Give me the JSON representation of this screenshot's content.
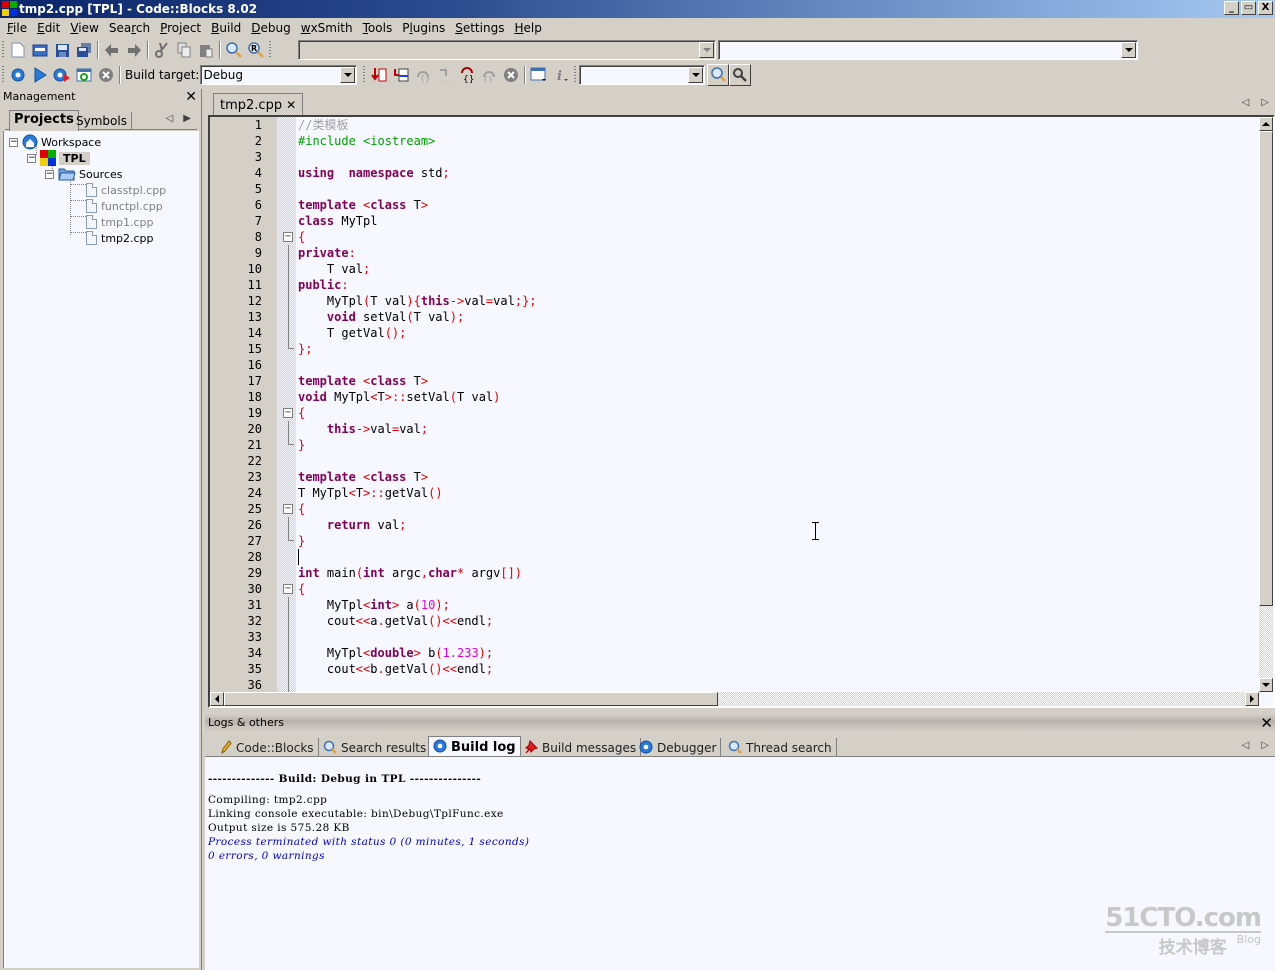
{
  "window": {
    "title": "tmp2.cpp [TPL] - Code::Blocks 8.02",
    "controls": {
      "minimize": "_",
      "restore": "▭",
      "close": "X"
    }
  },
  "menubar": [
    {
      "label": "File",
      "accel": "F"
    },
    {
      "label": "Edit",
      "accel": "E"
    },
    {
      "label": "View",
      "accel": "V"
    },
    {
      "label": "Search",
      "accel": "r"
    },
    {
      "label": "Project",
      "accel": "P"
    },
    {
      "label": "Build",
      "accel": "B"
    },
    {
      "label": "Debug",
      "accel": "D"
    },
    {
      "label": "wxSmith",
      "accel": "w"
    },
    {
      "label": "Tools",
      "accel": "T"
    },
    {
      "label": "Plugins",
      "accel": "l"
    },
    {
      "label": "Settings",
      "accel": "S"
    },
    {
      "label": "Help",
      "accel": "H"
    }
  ],
  "toolbar_main": {
    "buttons": [
      "new-file",
      "open",
      "save",
      "save-all",
      "undo",
      "redo",
      "cut",
      "copy",
      "paste",
      "find",
      "replace"
    ],
    "scope_combo": {
      "value": "",
      "disabled": true
    },
    "function_combo": {
      "value": ""
    }
  },
  "toolbar_build": {
    "buttons": [
      "build",
      "run",
      "build-and-run",
      "rebuild",
      "abort"
    ],
    "build_target_label": "Build target:",
    "build_target_value": "Debug"
  },
  "toolbar_debug": {
    "buttons": [
      "debug-run",
      "run-to-cursor",
      "next-line",
      "step-into",
      "step-out",
      "next-instruction",
      "stop-debugger",
      "debug-windows",
      "info"
    ]
  },
  "toolbar_search": {
    "search_value": "",
    "buttons": [
      "search-find",
      "search-options"
    ]
  },
  "management": {
    "title": "Management",
    "tabs": [
      {
        "label": "Projects",
        "active": true
      },
      {
        "label": "Symbols",
        "active": false
      }
    ],
    "tree": {
      "workspace": "Workspace",
      "project": "TPL",
      "folder": "Sources",
      "files": [
        {
          "name": "classtpl.cpp",
          "open": false
        },
        {
          "name": "functpl.cpp",
          "open": false
        },
        {
          "name": "tmp1.cpp",
          "open": false
        },
        {
          "name": "tmp2.cpp",
          "open": true
        }
      ]
    }
  },
  "editor": {
    "active_tab": "tmp2.cpp",
    "caret_line": 28,
    "lines": [
      {
        "n": "1",
        "tokens": [
          [
            "cm",
            "//类模板"
          ]
        ]
      },
      {
        "n": "2",
        "tokens": [
          [
            "pp",
            "#include <iostream>"
          ]
        ]
      },
      {
        "n": "3",
        "tokens": []
      },
      {
        "n": "4",
        "tokens": [
          [
            "kw",
            "using"
          ],
          [
            "",
            "  "
          ],
          [
            "kw",
            "namespace"
          ],
          [
            "",
            " std"
          ],
          [
            "op",
            ";"
          ]
        ]
      },
      {
        "n": "5",
        "tokens": []
      },
      {
        "n": "6",
        "tokens": [
          [
            "kw",
            "template"
          ],
          [
            "",
            " "
          ],
          [
            "op",
            "<"
          ],
          [
            "kw",
            "class"
          ],
          [
            "",
            " T"
          ],
          [
            "op",
            ">"
          ]
        ]
      },
      {
        "n": "7",
        "tokens": [
          [
            "kw",
            "class"
          ],
          [
            "",
            " MyTpl"
          ]
        ]
      },
      {
        "n": "8",
        "tokens": [
          [
            "op",
            "{"
          ]
        ],
        "fold": "start"
      },
      {
        "n": "9",
        "tokens": [
          [
            "kw",
            "private"
          ],
          [
            "op",
            ":"
          ]
        ],
        "fold": "mid"
      },
      {
        "n": "10",
        "tokens": [
          [
            "",
            "    T val"
          ],
          [
            "op",
            ";"
          ]
        ],
        "fold": "mid"
      },
      {
        "n": "11",
        "tokens": [
          [
            "kw",
            "public"
          ],
          [
            "op",
            ":"
          ]
        ],
        "fold": "mid"
      },
      {
        "n": "12",
        "tokens": [
          [
            "",
            "    MyTpl"
          ],
          [
            "op",
            "("
          ],
          [
            "",
            "T val"
          ],
          [
            "op",
            ")"
          ],
          [
            "op",
            "{"
          ],
          [
            "kw",
            "this"
          ],
          [
            "op",
            "->"
          ],
          [
            "",
            "val"
          ],
          [
            "op",
            "="
          ],
          [
            "",
            "val"
          ],
          [
            "op",
            ";"
          ],
          [
            "op",
            "}"
          ],
          [
            "op",
            ";"
          ]
        ],
        "fold": "mid"
      },
      {
        "n": "13",
        "tokens": [
          [
            "",
            "    "
          ],
          [
            "kw",
            "void"
          ],
          [
            "",
            " setVal"
          ],
          [
            "op",
            "("
          ],
          [
            "",
            "T val"
          ],
          [
            "op",
            ")"
          ],
          [
            "op",
            ";"
          ]
        ],
        "fold": "mid"
      },
      {
        "n": "14",
        "tokens": [
          [
            "",
            "    T getVal"
          ],
          [
            "op",
            "()"
          ],
          [
            "op",
            ";"
          ]
        ],
        "fold": "mid"
      },
      {
        "n": "15",
        "tokens": [
          [
            "op",
            "}"
          ],
          [
            "op",
            ";"
          ]
        ],
        "fold": "end"
      },
      {
        "n": "16",
        "tokens": []
      },
      {
        "n": "17",
        "tokens": [
          [
            "kw",
            "template"
          ],
          [
            "",
            " "
          ],
          [
            "op",
            "<"
          ],
          [
            "kw",
            "class"
          ],
          [
            "",
            " T"
          ],
          [
            "op",
            ">"
          ]
        ]
      },
      {
        "n": "18",
        "tokens": [
          [
            "kw",
            "void"
          ],
          [
            "",
            " MyTpl"
          ],
          [
            "op",
            "<"
          ],
          [
            "",
            "T"
          ],
          [
            "op",
            ">::"
          ],
          [
            "",
            "setVal"
          ],
          [
            "op",
            "("
          ],
          [
            "",
            "T val"
          ],
          [
            "op",
            ")"
          ]
        ]
      },
      {
        "n": "19",
        "tokens": [
          [
            "op",
            "{"
          ]
        ],
        "fold": "start"
      },
      {
        "n": "20",
        "tokens": [
          [
            "",
            "    "
          ],
          [
            "kw",
            "this"
          ],
          [
            "op",
            "->"
          ],
          [
            "",
            "val"
          ],
          [
            "op",
            "="
          ],
          [
            "",
            "val"
          ],
          [
            "op",
            ";"
          ]
        ],
        "fold": "mid"
      },
      {
        "n": "21",
        "tokens": [
          [
            "op",
            "}"
          ]
        ],
        "fold": "end"
      },
      {
        "n": "22",
        "tokens": []
      },
      {
        "n": "23",
        "tokens": [
          [
            "kw",
            "template"
          ],
          [
            "",
            " "
          ],
          [
            "op",
            "<"
          ],
          [
            "kw",
            "class"
          ],
          [
            "",
            " T"
          ],
          [
            "op",
            ">"
          ]
        ]
      },
      {
        "n": "24",
        "tokens": [
          [
            "",
            "T MyTpl"
          ],
          [
            "op",
            "<"
          ],
          [
            "",
            "T"
          ],
          [
            "op",
            ">::"
          ],
          [
            "",
            "getVal"
          ],
          [
            "op",
            "()"
          ]
        ]
      },
      {
        "n": "25",
        "tokens": [
          [
            "op",
            "{"
          ]
        ],
        "fold": "start"
      },
      {
        "n": "26",
        "tokens": [
          [
            "",
            "    "
          ],
          [
            "kw",
            "return"
          ],
          [
            "",
            " val"
          ],
          [
            "op",
            ";"
          ]
        ],
        "fold": "mid"
      },
      {
        "n": "27",
        "tokens": [
          [
            "op",
            "}"
          ]
        ],
        "fold": "end"
      },
      {
        "n": "28",
        "tokens": []
      },
      {
        "n": "29",
        "tokens": [
          [
            "kw",
            "int"
          ],
          [
            "",
            " main"
          ],
          [
            "op",
            "("
          ],
          [
            "kw",
            "int"
          ],
          [
            "",
            " argc"
          ],
          [
            "op",
            ","
          ],
          [
            "kw",
            "char"
          ],
          [
            "op",
            "*"
          ],
          [
            "",
            " argv"
          ],
          [
            "op",
            "[])"
          ]
        ]
      },
      {
        "n": "30",
        "tokens": [
          [
            "op",
            "{"
          ]
        ],
        "fold": "start"
      },
      {
        "n": "31",
        "tokens": [
          [
            "",
            "    MyTpl"
          ],
          [
            "op",
            "<"
          ],
          [
            "kw",
            "int"
          ],
          [
            "op",
            ">"
          ],
          [
            "",
            " a"
          ],
          [
            "op",
            "("
          ],
          [
            "num",
            "10"
          ],
          [
            "op",
            ")"
          ],
          [
            "op",
            ";"
          ]
        ],
        "fold": "mid"
      },
      {
        "n": "32",
        "tokens": [
          [
            "",
            "    cout"
          ],
          [
            "op",
            "<<"
          ],
          [
            "",
            "a"
          ],
          [
            "op",
            "."
          ],
          [
            "",
            "getVal"
          ],
          [
            "op",
            "()"
          ],
          [
            "op",
            "<<"
          ],
          [
            "",
            "endl"
          ],
          [
            "op",
            ";"
          ]
        ],
        "fold": "mid"
      },
      {
        "n": "33",
        "tokens": [],
        "fold": "mid"
      },
      {
        "n": "34",
        "tokens": [
          [
            "",
            "    MyTpl"
          ],
          [
            "op",
            "<"
          ],
          [
            "kw",
            "double"
          ],
          [
            "op",
            ">"
          ],
          [
            "",
            " b"
          ],
          [
            "op",
            "("
          ],
          [
            "num",
            "1.233"
          ],
          [
            "op",
            ")"
          ],
          [
            "op",
            ";"
          ]
        ],
        "fold": "mid"
      },
      {
        "n": "35",
        "tokens": [
          [
            "",
            "    cout"
          ],
          [
            "op",
            "<<"
          ],
          [
            "",
            "b"
          ],
          [
            "op",
            "."
          ],
          [
            "",
            "getVal"
          ],
          [
            "op",
            "()"
          ],
          [
            "op",
            "<<"
          ],
          [
            "",
            "endl"
          ],
          [
            "op",
            ";"
          ]
        ],
        "fold": "mid"
      },
      {
        "n": "36",
        "tokens": [],
        "fold": "mid"
      }
    ]
  },
  "logs": {
    "title": "Logs & others",
    "tabs": [
      {
        "label": "Code::Blocks",
        "icon": "pencil-icon",
        "active": false
      },
      {
        "label": "Search results",
        "icon": "magnifier-icon",
        "active": false
      },
      {
        "label": "Build log",
        "icon": "gear-icon",
        "active": true
      },
      {
        "label": "Build messages",
        "icon": "pushpin-icon",
        "active": false
      },
      {
        "label": "Debugger",
        "icon": "gear-icon",
        "active": false
      },
      {
        "label": "Thread search",
        "icon": "magnifier-icon",
        "active": false
      }
    ],
    "build_log": [
      {
        "text": "-------------- Build: Debug in TPL ---------------",
        "style": "hdr"
      },
      {
        "text": "Compiling: tmp2.cpp",
        "style": ""
      },
      {
        "text": "Linking console executable: bin\\Debug\\TplFunc.exe",
        "style": ""
      },
      {
        "text": "Output size is 575.28 KB",
        "style": ""
      },
      {
        "text": "Process terminated with status 0 (0 minutes, 1 seconds)",
        "style": "blue"
      },
      {
        "text": "0 errors, 0 warnings",
        "style": "blue"
      }
    ]
  },
  "watermark": {
    "brand": "51CTO.com",
    "sub": "技术博客",
    "blog": "Blog"
  },
  "colors": {
    "keyword": "#7f0055",
    "operator": "#e00000",
    "preprocessor": "#00a000",
    "comment": "#a0a0a0",
    "number": "#e000e0",
    "log_status": "#0000c0",
    "editor_bg": "#f7f7ff",
    "chrome_bg": "#d4d0c8"
  }
}
